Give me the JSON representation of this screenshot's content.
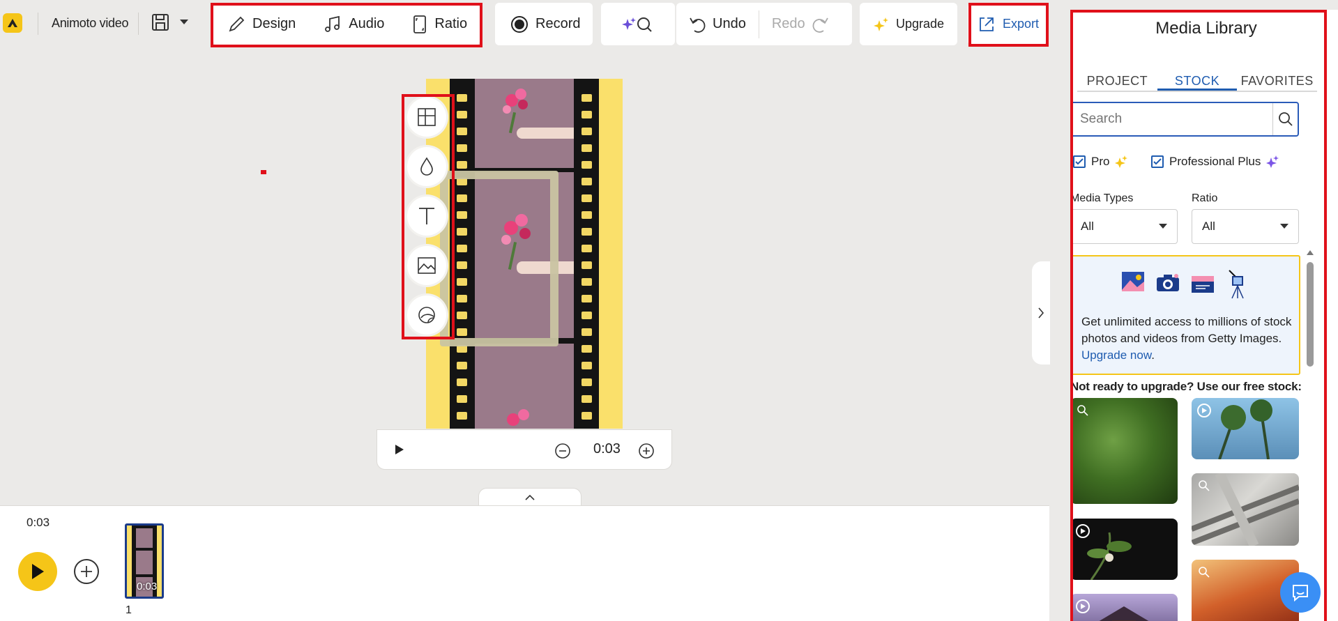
{
  "toolbar": {
    "project_name": "Animoto video",
    "design_label": "Design",
    "audio_label": "Audio",
    "ratio_label": "Ratio",
    "record_label": "Record",
    "undo_label": "Undo",
    "redo_label": "Redo",
    "upgrade_label": "Upgrade",
    "export_label": "Export"
  },
  "side_tools": [
    {
      "icon": "layout-icon"
    },
    {
      "icon": "color-drop-icon"
    },
    {
      "icon": "text-icon"
    },
    {
      "icon": "image-icon"
    },
    {
      "icon": "sticker-icon"
    }
  ],
  "preview": {
    "current_time": "0:03"
  },
  "timeline": {
    "total_time": "0:03",
    "scene_duration": "0:03",
    "scene_number": "1"
  },
  "media_library": {
    "title": "Media Library",
    "tabs": [
      {
        "label": "PROJECT",
        "active": false
      },
      {
        "label": "STOCK",
        "active": true
      },
      {
        "label": "FAVORITES",
        "active": false
      }
    ],
    "search_placeholder": "Search",
    "filters": {
      "pro_label": "Pro",
      "pro_checked": true,
      "professional_plus_label": "Professional Plus",
      "professional_plus_checked": true,
      "media_types_label": "Media Types",
      "media_types_value": "All",
      "ratio_label": "Ratio",
      "ratio_value": "All"
    },
    "promo": {
      "text": "Get unlimited access to millions of stock photos and videos from Getty Images.",
      "link": "Upgrade now",
      "after_link": "."
    },
    "free_stock_heading": "Not ready to upgrade? Use our free stock:"
  },
  "colors": {
    "accent_blue": "#1f5cb0",
    "brand_yellow": "#f5c518",
    "annotation_red": "#e0101a"
  }
}
